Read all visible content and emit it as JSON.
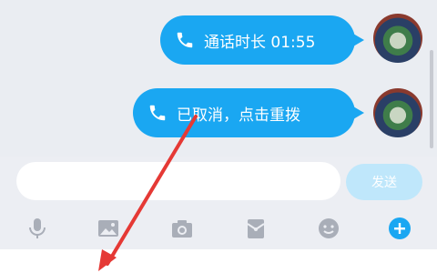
{
  "messages": [
    {
      "icon": "phone-icon",
      "text": "通话时长 01:55"
    },
    {
      "icon": "phone-icon",
      "text": "已取消，点击重拨"
    }
  ],
  "input": {
    "value": "",
    "placeholder": ""
  },
  "send_label": "发送",
  "toolbar": [
    "microphone-icon",
    "image-icon",
    "camera-icon",
    "red-packet-icon",
    "emoji-icon",
    "plus-icon"
  ],
  "colors": {
    "bubble": "#1aa7f2",
    "send_button_disabled": "#bfe7fb",
    "toolbar_icon": "#a9aeb8",
    "plus_button": "#1aa7f2",
    "annotation_arrow": "#e53935"
  }
}
